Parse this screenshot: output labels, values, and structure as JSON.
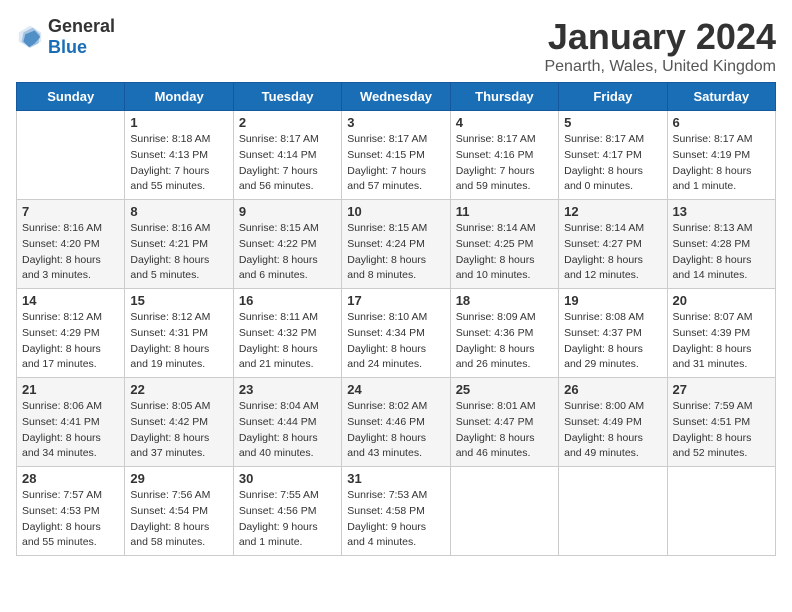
{
  "logo": {
    "general": "General",
    "blue": "Blue"
  },
  "title": "January 2024",
  "location": "Penarth, Wales, United Kingdom",
  "weekdays": [
    "Sunday",
    "Monday",
    "Tuesday",
    "Wednesday",
    "Thursday",
    "Friday",
    "Saturday"
  ],
  "weeks": [
    [
      {
        "day": "",
        "sunrise": "",
        "sunset": "",
        "daylight": ""
      },
      {
        "day": "1",
        "sunrise": "Sunrise: 8:18 AM",
        "sunset": "Sunset: 4:13 PM",
        "daylight": "Daylight: 7 hours and 55 minutes."
      },
      {
        "day": "2",
        "sunrise": "Sunrise: 8:17 AM",
        "sunset": "Sunset: 4:14 PM",
        "daylight": "Daylight: 7 hours and 56 minutes."
      },
      {
        "day": "3",
        "sunrise": "Sunrise: 8:17 AM",
        "sunset": "Sunset: 4:15 PM",
        "daylight": "Daylight: 7 hours and 57 minutes."
      },
      {
        "day": "4",
        "sunrise": "Sunrise: 8:17 AM",
        "sunset": "Sunset: 4:16 PM",
        "daylight": "Daylight: 7 hours and 59 minutes."
      },
      {
        "day": "5",
        "sunrise": "Sunrise: 8:17 AM",
        "sunset": "Sunset: 4:17 PM",
        "daylight": "Daylight: 8 hours and 0 minutes."
      },
      {
        "day": "6",
        "sunrise": "Sunrise: 8:17 AM",
        "sunset": "Sunset: 4:19 PM",
        "daylight": "Daylight: 8 hours and 1 minute."
      }
    ],
    [
      {
        "day": "7",
        "sunrise": "Sunrise: 8:16 AM",
        "sunset": "Sunset: 4:20 PM",
        "daylight": "Daylight: 8 hours and 3 minutes."
      },
      {
        "day": "8",
        "sunrise": "Sunrise: 8:16 AM",
        "sunset": "Sunset: 4:21 PM",
        "daylight": "Daylight: 8 hours and 5 minutes."
      },
      {
        "day": "9",
        "sunrise": "Sunrise: 8:15 AM",
        "sunset": "Sunset: 4:22 PM",
        "daylight": "Daylight: 8 hours and 6 minutes."
      },
      {
        "day": "10",
        "sunrise": "Sunrise: 8:15 AM",
        "sunset": "Sunset: 4:24 PM",
        "daylight": "Daylight: 8 hours and 8 minutes."
      },
      {
        "day": "11",
        "sunrise": "Sunrise: 8:14 AM",
        "sunset": "Sunset: 4:25 PM",
        "daylight": "Daylight: 8 hours and 10 minutes."
      },
      {
        "day": "12",
        "sunrise": "Sunrise: 8:14 AM",
        "sunset": "Sunset: 4:27 PM",
        "daylight": "Daylight: 8 hours and 12 minutes."
      },
      {
        "day": "13",
        "sunrise": "Sunrise: 8:13 AM",
        "sunset": "Sunset: 4:28 PM",
        "daylight": "Daylight: 8 hours and 14 minutes."
      }
    ],
    [
      {
        "day": "14",
        "sunrise": "Sunrise: 8:12 AM",
        "sunset": "Sunset: 4:29 PM",
        "daylight": "Daylight: 8 hours and 17 minutes."
      },
      {
        "day": "15",
        "sunrise": "Sunrise: 8:12 AM",
        "sunset": "Sunset: 4:31 PM",
        "daylight": "Daylight: 8 hours and 19 minutes."
      },
      {
        "day": "16",
        "sunrise": "Sunrise: 8:11 AM",
        "sunset": "Sunset: 4:32 PM",
        "daylight": "Daylight: 8 hours and 21 minutes."
      },
      {
        "day": "17",
        "sunrise": "Sunrise: 8:10 AM",
        "sunset": "Sunset: 4:34 PM",
        "daylight": "Daylight: 8 hours and 24 minutes."
      },
      {
        "day": "18",
        "sunrise": "Sunrise: 8:09 AM",
        "sunset": "Sunset: 4:36 PM",
        "daylight": "Daylight: 8 hours and 26 minutes."
      },
      {
        "day": "19",
        "sunrise": "Sunrise: 8:08 AM",
        "sunset": "Sunset: 4:37 PM",
        "daylight": "Daylight: 8 hours and 29 minutes."
      },
      {
        "day": "20",
        "sunrise": "Sunrise: 8:07 AM",
        "sunset": "Sunset: 4:39 PM",
        "daylight": "Daylight: 8 hours and 31 minutes."
      }
    ],
    [
      {
        "day": "21",
        "sunrise": "Sunrise: 8:06 AM",
        "sunset": "Sunset: 4:41 PM",
        "daylight": "Daylight: 8 hours and 34 minutes."
      },
      {
        "day": "22",
        "sunrise": "Sunrise: 8:05 AM",
        "sunset": "Sunset: 4:42 PM",
        "daylight": "Daylight: 8 hours and 37 minutes."
      },
      {
        "day": "23",
        "sunrise": "Sunrise: 8:04 AM",
        "sunset": "Sunset: 4:44 PM",
        "daylight": "Daylight: 8 hours and 40 minutes."
      },
      {
        "day": "24",
        "sunrise": "Sunrise: 8:02 AM",
        "sunset": "Sunset: 4:46 PM",
        "daylight": "Daylight: 8 hours and 43 minutes."
      },
      {
        "day": "25",
        "sunrise": "Sunrise: 8:01 AM",
        "sunset": "Sunset: 4:47 PM",
        "daylight": "Daylight: 8 hours and 46 minutes."
      },
      {
        "day": "26",
        "sunrise": "Sunrise: 8:00 AM",
        "sunset": "Sunset: 4:49 PM",
        "daylight": "Daylight: 8 hours and 49 minutes."
      },
      {
        "day": "27",
        "sunrise": "Sunrise: 7:59 AM",
        "sunset": "Sunset: 4:51 PM",
        "daylight": "Daylight: 8 hours and 52 minutes."
      }
    ],
    [
      {
        "day": "28",
        "sunrise": "Sunrise: 7:57 AM",
        "sunset": "Sunset: 4:53 PM",
        "daylight": "Daylight: 8 hours and 55 minutes."
      },
      {
        "day": "29",
        "sunrise": "Sunrise: 7:56 AM",
        "sunset": "Sunset: 4:54 PM",
        "daylight": "Daylight: 8 hours and 58 minutes."
      },
      {
        "day": "30",
        "sunrise": "Sunrise: 7:55 AM",
        "sunset": "Sunset: 4:56 PM",
        "daylight": "Daylight: 9 hours and 1 minute."
      },
      {
        "day": "31",
        "sunrise": "Sunrise: 7:53 AM",
        "sunset": "Sunset: 4:58 PM",
        "daylight": "Daylight: 9 hours and 4 minutes."
      },
      {
        "day": "",
        "sunrise": "",
        "sunset": "",
        "daylight": ""
      },
      {
        "day": "",
        "sunrise": "",
        "sunset": "",
        "daylight": ""
      },
      {
        "day": "",
        "sunrise": "",
        "sunset": "",
        "daylight": ""
      }
    ]
  ]
}
